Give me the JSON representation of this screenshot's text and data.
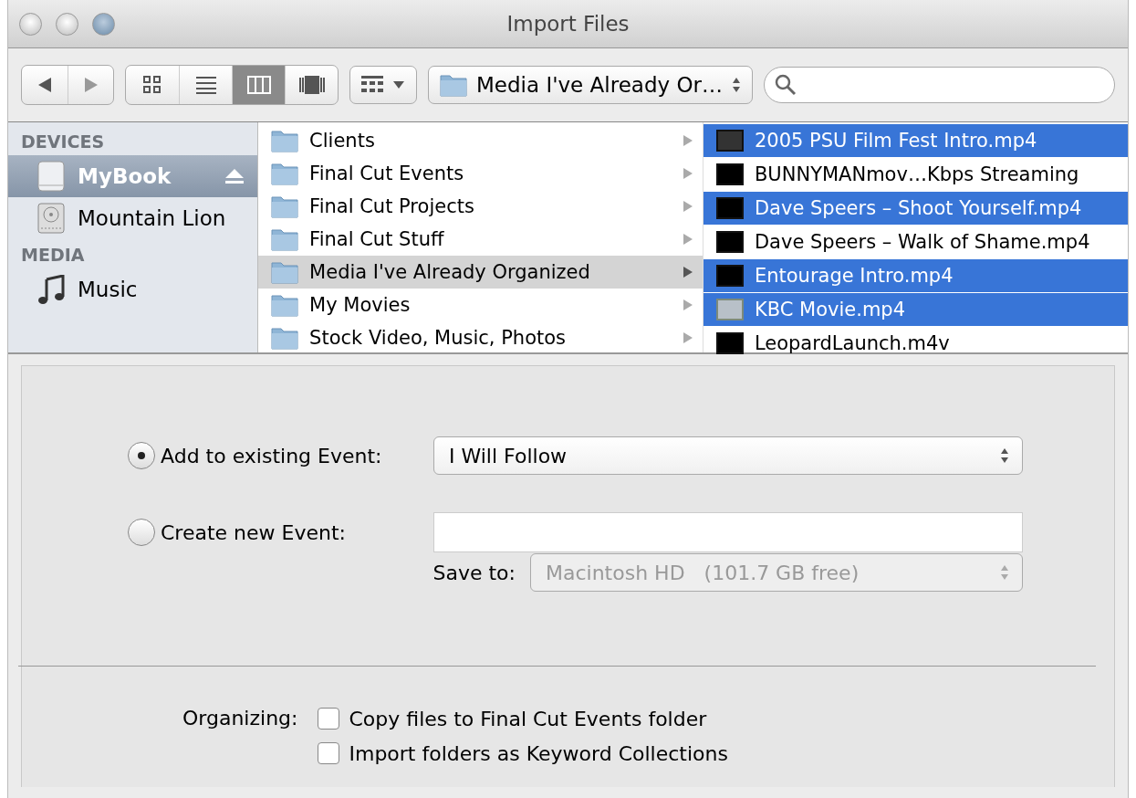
{
  "window": {
    "title": "Import Files"
  },
  "toolbar": {
    "view_modes": [
      {
        "kind": "icons",
        "selected": false
      },
      {
        "kind": "list",
        "selected": false
      },
      {
        "kind": "columns",
        "selected": true
      },
      {
        "kind": "coverflow",
        "selected": false
      }
    ],
    "path_popup": "Media I've Already Or…"
  },
  "sidebar": [
    {
      "heading": "DEVICES",
      "items": [
        {
          "label": "MyBook",
          "kind": "drive",
          "selected": true,
          "ejectable": true
        },
        {
          "label": "Mountain Lion",
          "kind": "disk",
          "selected": false,
          "ejectable": false
        }
      ]
    },
    {
      "heading": "MEDIA",
      "items": [
        {
          "label": "Music",
          "kind": "music",
          "selected": false,
          "ejectable": false
        }
      ]
    }
  ],
  "column_1": [
    {
      "label": "Clients",
      "selected": false
    },
    {
      "label": "Final Cut Events",
      "selected": false
    },
    {
      "label": "Final Cut Projects",
      "selected": false
    },
    {
      "label": "Final Cut Stuff",
      "selected": false
    },
    {
      "label": "Media I've Already Organized",
      "selected": true
    },
    {
      "label": "My Movies",
      "selected": false
    },
    {
      "label": "Stock Video, Music, Photos",
      "selected": false
    }
  ],
  "column_2": [
    {
      "label": "2005 PSU Film Fest Intro.mp4",
      "selected": true
    },
    {
      "label": "BUNNYMANmov…Kbps Streaming",
      "selected": false
    },
    {
      "label": "Dave Speers – Shoot Yourself.mp4",
      "selected": true
    },
    {
      "label": "Dave Speers – Walk of Shame.mp4",
      "selected": false
    },
    {
      "label": "Entourage Intro.mp4",
      "selected": true
    },
    {
      "label": "KBC Movie.mp4",
      "selected": true
    },
    {
      "label": "LeopardLaunch.m4v",
      "selected": false
    }
  ],
  "event_options": [
    {
      "label": "Add to existing Event:",
      "selected": true,
      "kind": "popup",
      "value": "I Will Follow"
    },
    {
      "label": "Create new Event:",
      "selected": false,
      "kind": "field"
    }
  ],
  "save_to": {
    "label": "Save to:",
    "value": "Macintosh HD   (101.7 GB free)",
    "disabled": true
  },
  "organizing": {
    "label": "Organizing:",
    "options": [
      {
        "label": "Copy files to Final Cut Events folder",
        "checked": false
      },
      {
        "label": "Import folders as Keyword Collections",
        "checked": false
      }
    ]
  }
}
